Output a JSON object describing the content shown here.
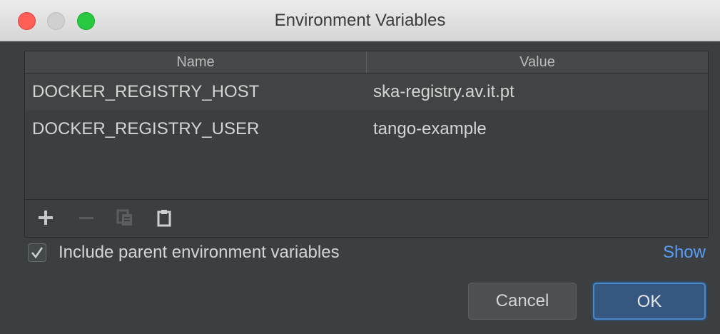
{
  "window": {
    "title": "Environment Variables"
  },
  "table": {
    "columns": [
      "Name",
      "Value"
    ],
    "rows": [
      {
        "name": "DOCKER_REGISTRY_HOST",
        "value": "ska-registry.av.it.pt"
      },
      {
        "name": "DOCKER_REGISTRY_USER",
        "value": "tango-example"
      }
    ]
  },
  "toolbar": {
    "icons": [
      "plus-icon",
      "minus-icon",
      "copy-icon",
      "paste-icon"
    ]
  },
  "options": {
    "include_parent_label": "Include parent environment variables",
    "include_parent_checked": true,
    "show_link": "Show"
  },
  "buttons": {
    "cancel": "Cancel",
    "ok": "OK"
  },
  "colors": {
    "accent": "#589df6",
    "ok_button": "#365880",
    "close": "#ff5f57",
    "zoom": "#28c940"
  }
}
